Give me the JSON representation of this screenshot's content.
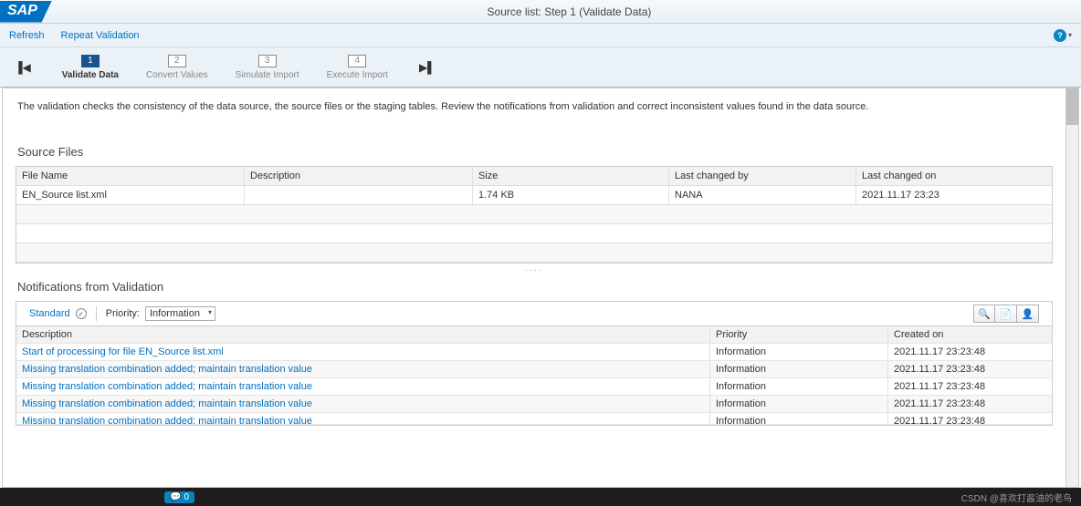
{
  "header": {
    "logo": "SAP",
    "title": "Source list: Step 1  (Validate Data)"
  },
  "toolbar": {
    "refresh": "Refresh",
    "repeat": "Repeat Validation"
  },
  "steps": {
    "items": [
      {
        "num": "1",
        "label": "Validate Data"
      },
      {
        "num": "2",
        "label": "Convert Values"
      },
      {
        "num": "3",
        "label": "Simulate Import"
      },
      {
        "num": "4",
        "label": "Execute Import"
      }
    ]
  },
  "info_text": "The validation checks the consistency of the data source, the source files or the staging tables. Review the notifications from validation and correct inconsistent values found in the data source.",
  "source_files": {
    "title": "Source Files",
    "headers": {
      "fname": "File Name",
      "desc": "Description",
      "size": "Size",
      "chby": "Last changed by",
      "chon": "Last changed on"
    },
    "rows": [
      {
        "fname": "EN_Source list.xml",
        "desc": "",
        "size": "1.74 KB",
        "chby": "NANA",
        "chon": "2021.11.17 23:23"
      }
    ]
  },
  "notifications": {
    "title": "Notifications from Validation",
    "standard": "Standard",
    "priority_label": "Priority:",
    "priority_value": "Information",
    "headers": {
      "desc": "Description",
      "prio": "Priority",
      "time": "Created on"
    },
    "rows": [
      {
        "desc": "Start of processing for file EN_Source list.xml",
        "prio": "Information",
        "time": "2021.11.17 23:23:48"
      },
      {
        "desc": "Missing translation combination added; maintain translation value",
        "prio": "Information",
        "time": "2021.11.17 23:23:48"
      },
      {
        "desc": "Missing translation combination added; maintain translation value",
        "prio": "Information",
        "time": "2021.11.17 23:23:48"
      },
      {
        "desc": "Missing translation combination added; maintain translation value",
        "prio": "Information",
        "time": "2021.11.17 23:23:48"
      },
      {
        "desc": "Missing translation combination added; maintain translation value",
        "prio": "Information",
        "time": "2021.11.17 23:23:48"
      }
    ]
  },
  "bottom": {
    "comment_count": "0",
    "watermark": "CSDN @喜欢打酱油的老鸟"
  }
}
